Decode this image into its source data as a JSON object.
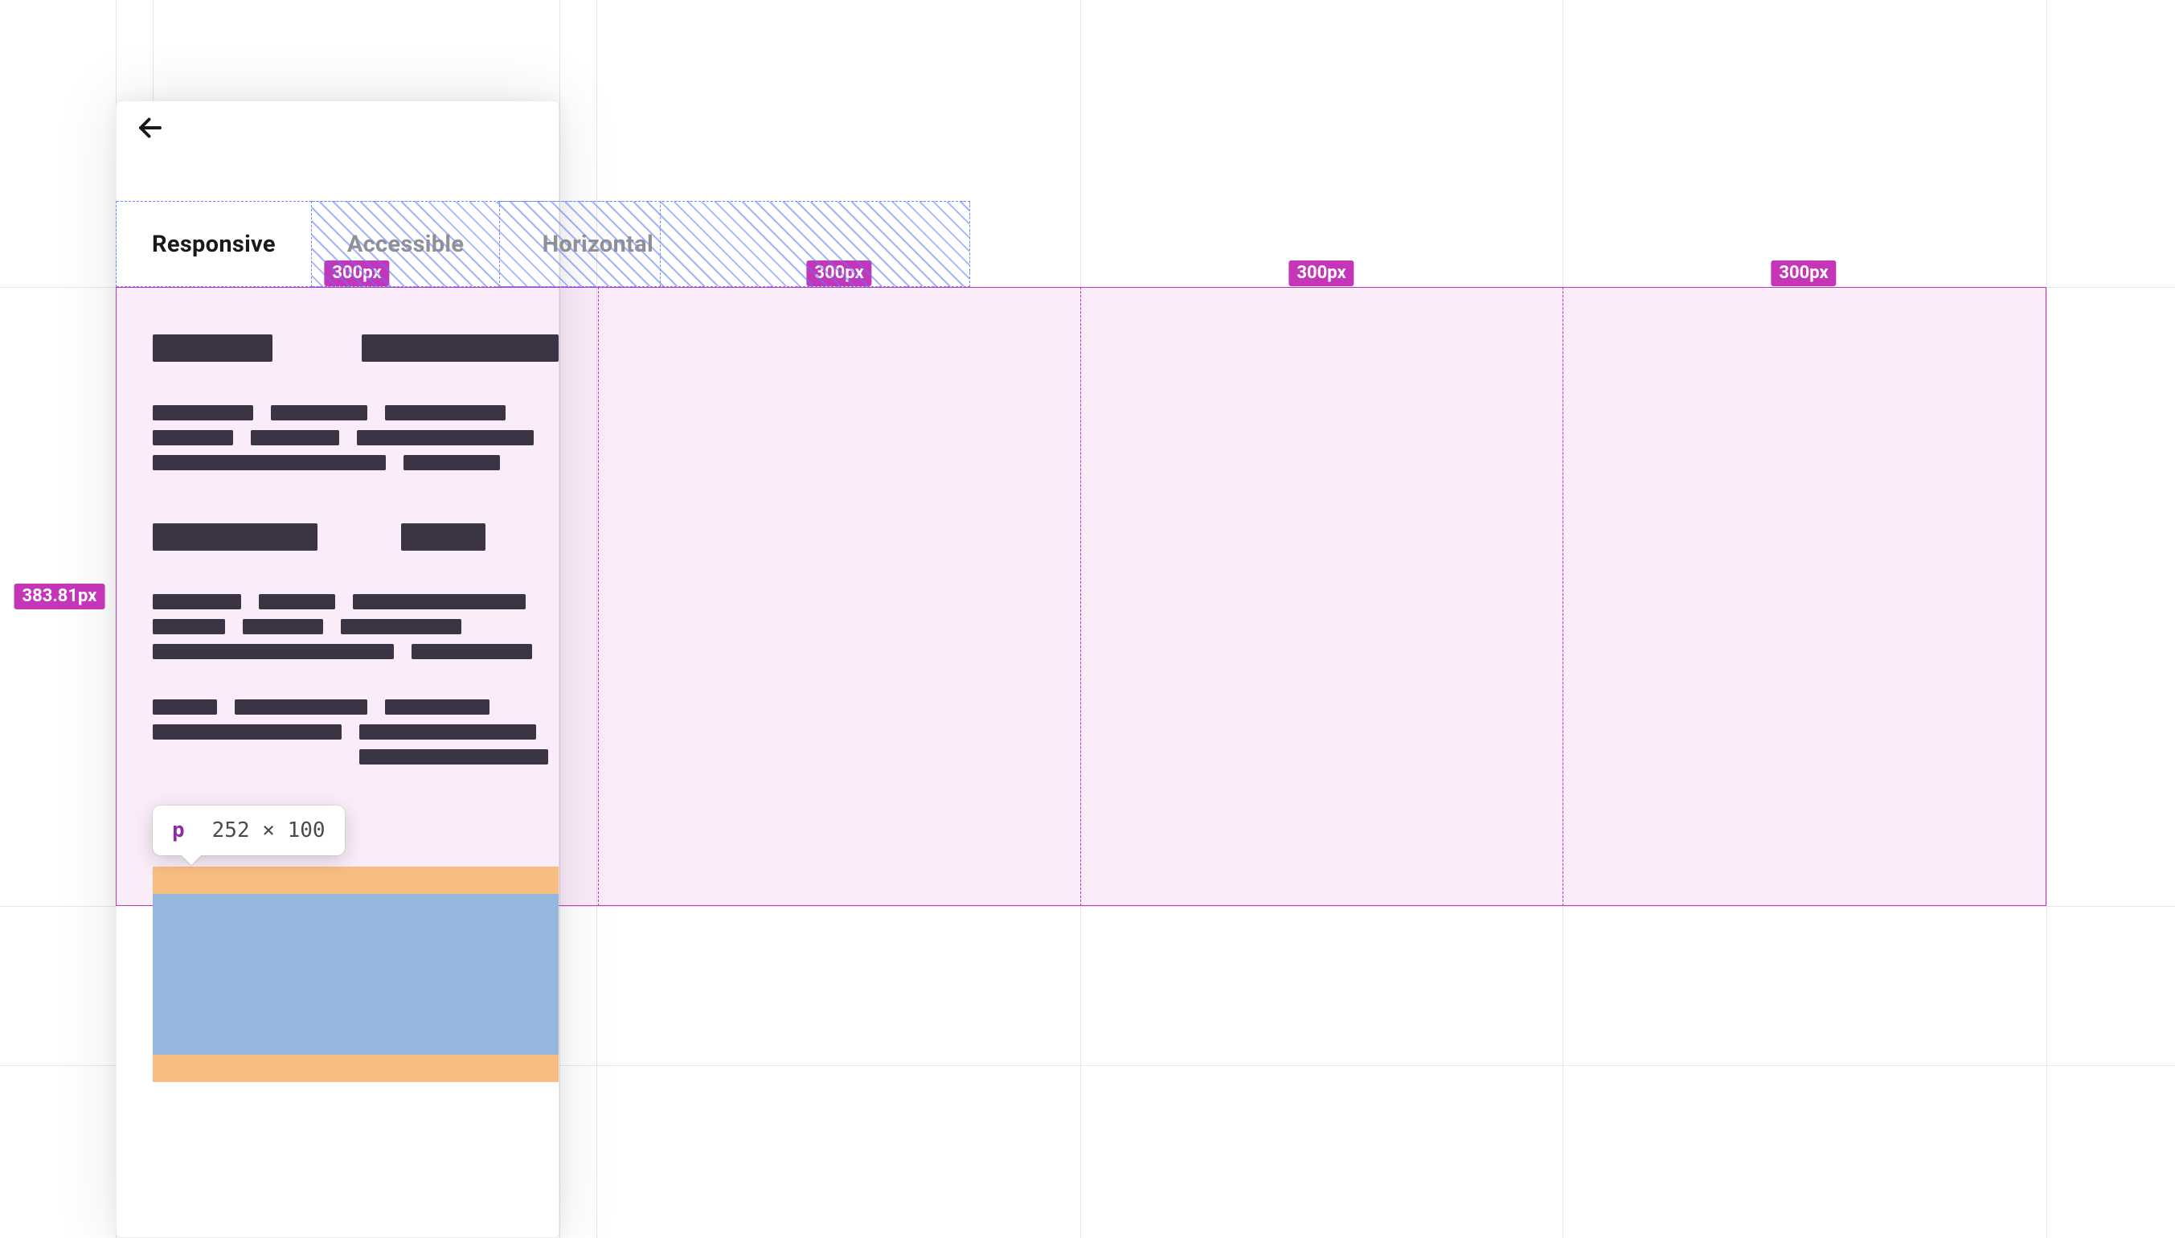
{
  "tabs": {
    "items": [
      {
        "label": "Responsive",
        "active": true
      },
      {
        "label": "Accessible",
        "active": false
      },
      {
        "label": "Horizontal",
        "active": false
      }
    ],
    "clipped_third_visible_chars": "Horiz"
  },
  "grid_overlay": {
    "column_labels": [
      "300px",
      "300px",
      "300px",
      "300px"
    ],
    "row_label": "383.81px"
  },
  "inspector_tooltip": {
    "tag": "p",
    "dimensions": "252 × 100"
  },
  "colors": {
    "grid_accent": "#c435b8",
    "flex_dash": "#6a8bff",
    "margin_highlight": "#f8bd80",
    "content_highlight": "#95b7dd",
    "skeleton": "#3a3445"
  }
}
